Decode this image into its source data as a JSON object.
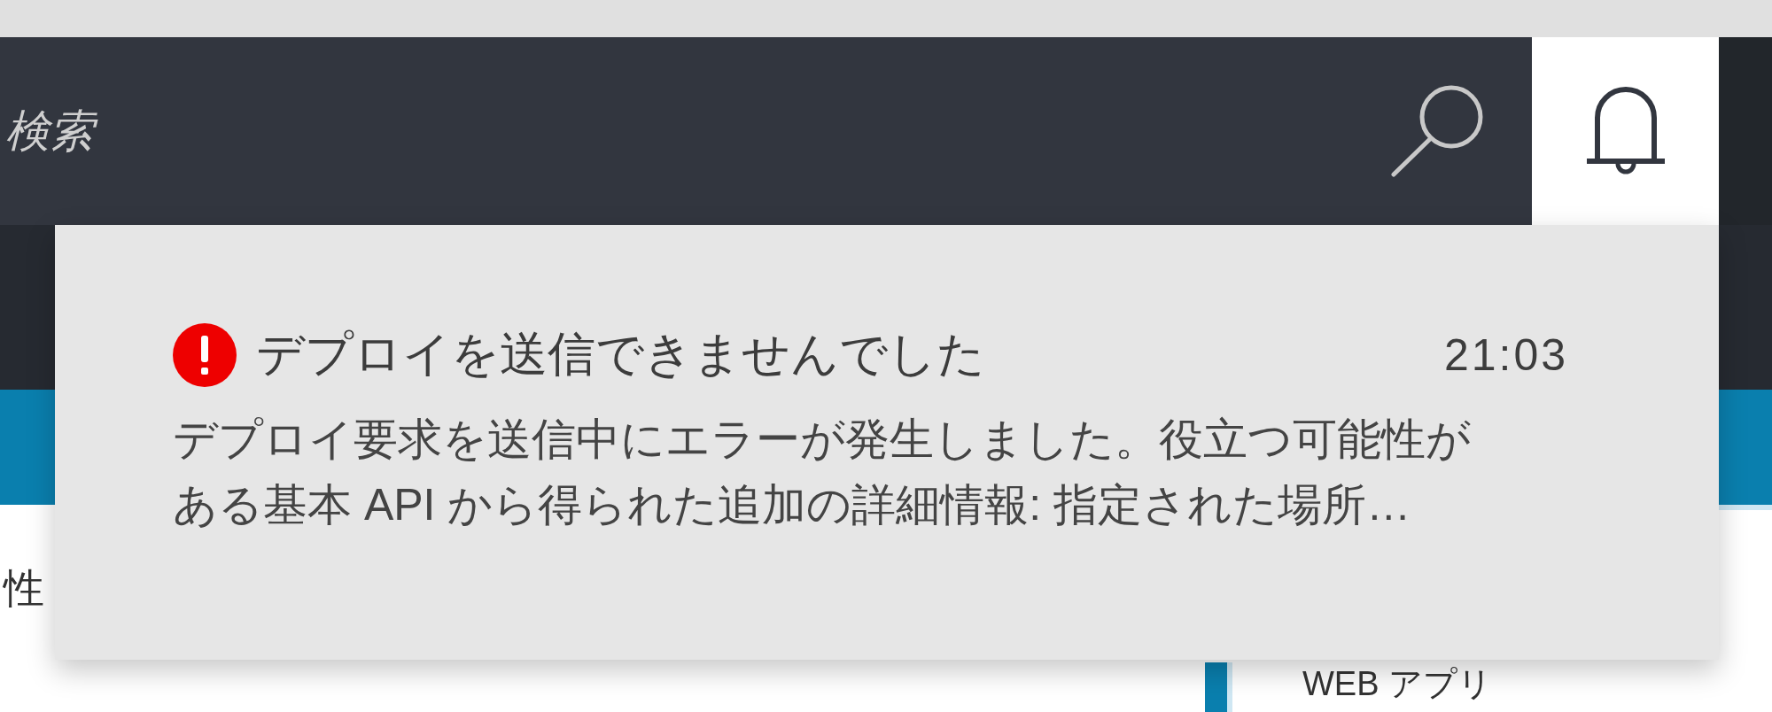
{
  "search": {
    "placeholder": "検索"
  },
  "notifications_button": {
    "selected": true
  },
  "notification": {
    "kind": "error",
    "title": "デプロイを送信できませんでした",
    "time": "21:03",
    "message_lines": [
      "デプロイ要求を送信中にエラーが発生しました。役立つ可能性が",
      "ある基本 API から得られた追加の詳細情報: 指定された場所…"
    ]
  },
  "background": {
    "side_label": "性",
    "list_item": "WEB アプリ"
  }
}
